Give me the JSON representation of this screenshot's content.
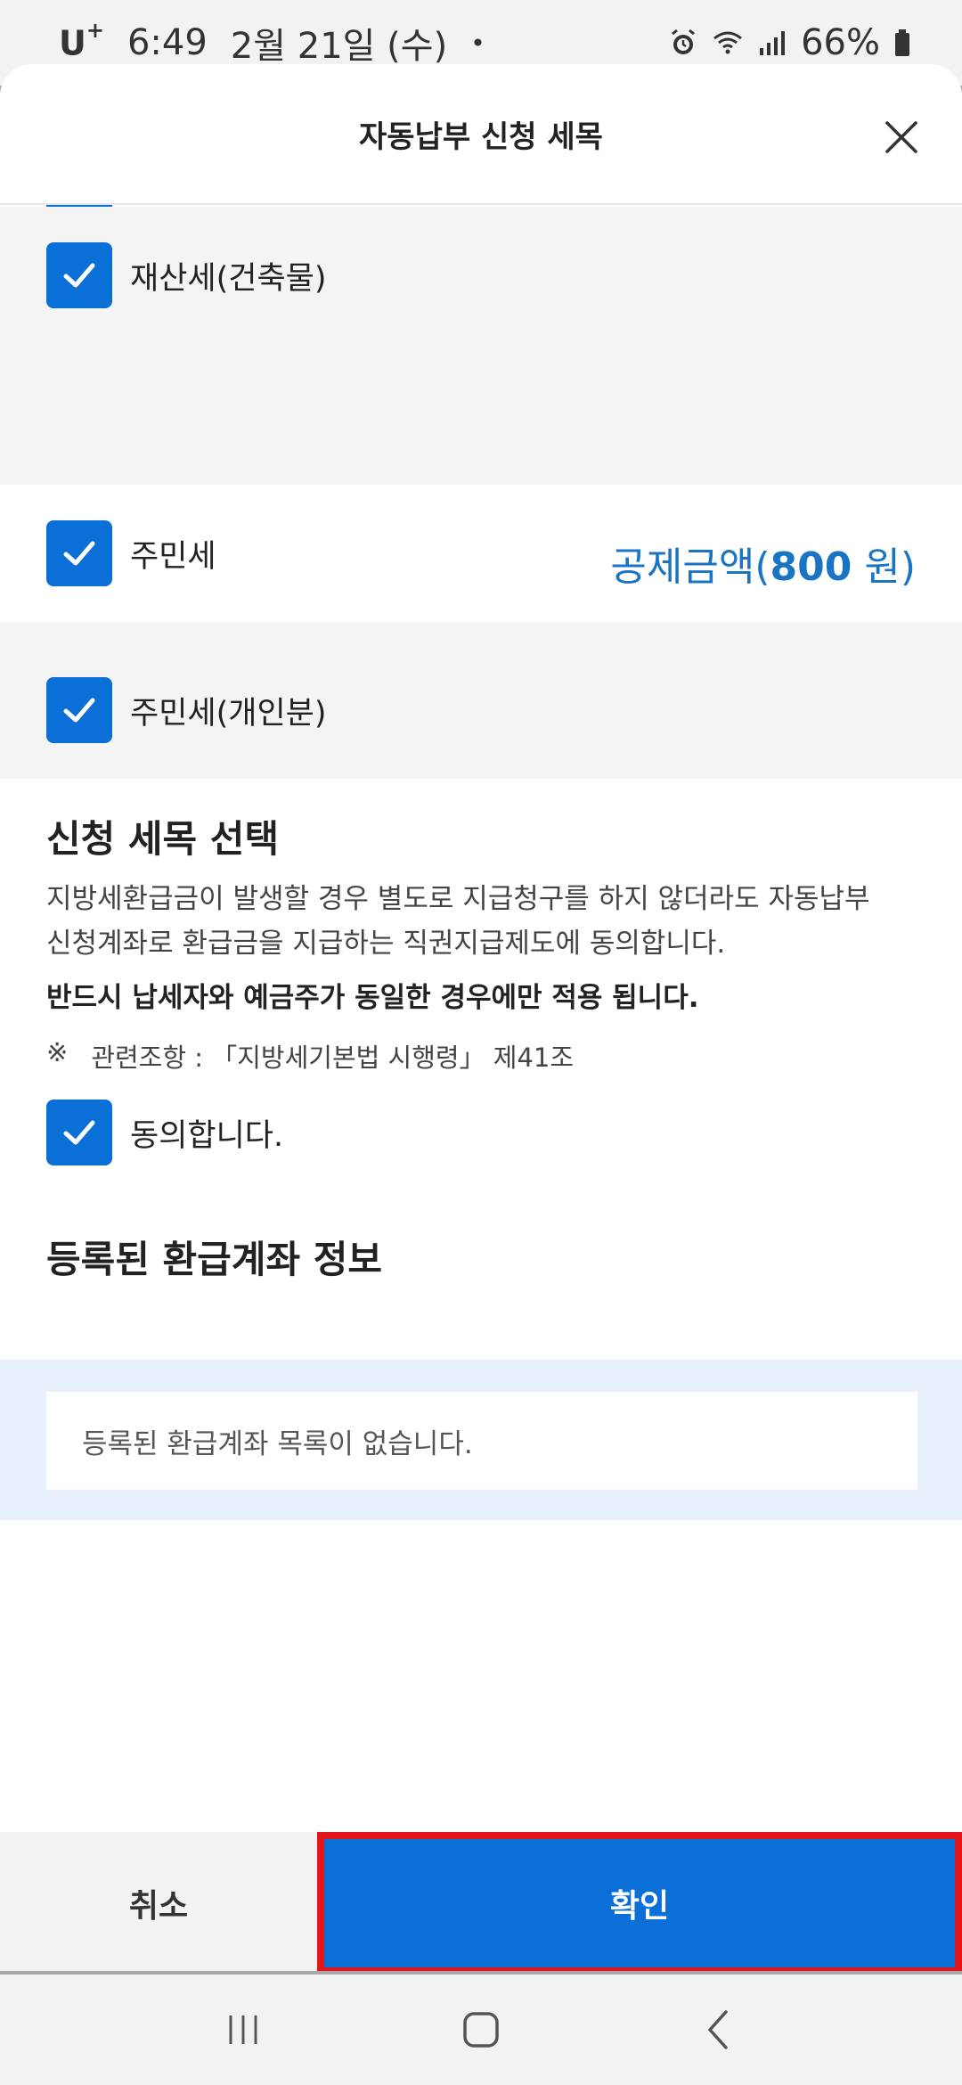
{
  "status_bar": {
    "carrier": "U",
    "carrier_sup": "+",
    "time": "6:49",
    "date": "2월 21일 (수)",
    "dot": "•",
    "battery": "66%"
  },
  "sheet": {
    "title": "자동납부 신청 세목"
  },
  "items": [
    {
      "label": "재산세(건축물)",
      "checked": true
    },
    {
      "label": "주민세",
      "checked": true
    },
    {
      "label": "주민세(개인분)",
      "checked": true
    }
  ],
  "deduction": {
    "prefix": "공제금액(",
    "amount": "800",
    "suffix": " 원)"
  },
  "select_section": {
    "heading": "신청 세목 선택",
    "paragraph_line1": "지방세환급금이 발생할 경우 별도로 지급청구를 하지 않더라도 자동납부",
    "paragraph_line2": "신청계좌로 환급금을 지급하는 직권지급제도에 동의합니다.",
    "bold_note": "반드시 납세자와 예금주가 동일한 경우에만 적용 됩니다.",
    "ref_mark": "※",
    "ref_text": "관련조항 : 「지방세기본법 시행령」 제41조",
    "agree_label": "동의합니다."
  },
  "account_section": {
    "heading": "등록된 환급계좌 정보",
    "empty_message": "등록된 환급계좌 목록이 없습니다."
  },
  "buttons": {
    "cancel": "취소",
    "confirm": "확인"
  },
  "colors": {
    "accent": "#0a6fd6",
    "deduction_text": "#1a74c4",
    "highlight_border": "#e3171b"
  }
}
